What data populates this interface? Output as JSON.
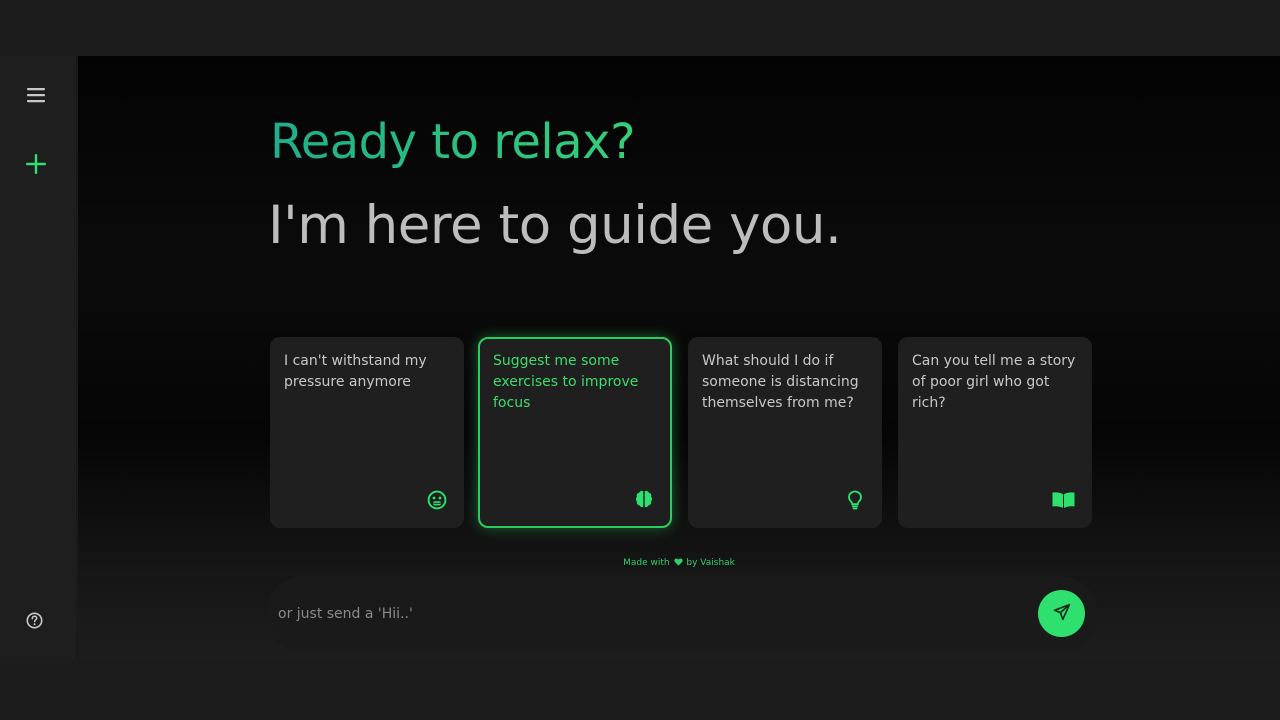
{
  "sidebar": {
    "menu_icon": "menu-icon",
    "new_chat_icon": "plus-icon",
    "help_icon": "help-icon"
  },
  "greeting": {
    "line1": "Ready to relax?",
    "line2": "I'm here to guide you."
  },
  "cards": [
    {
      "text": "I can't withstand my pressure anymore",
      "icon": "stressed-face-icon",
      "active": false
    },
    {
      "text": "Suggest me some exercises to improve focus",
      "icon": "brain-icon",
      "active": true
    },
    {
      "text": "What should I do if someone is distancing themselves from me?",
      "icon": "lightbulb-icon",
      "active": false
    },
    {
      "text": "Can you tell me a story of poor girl who got rich?",
      "icon": "book-icon",
      "active": false
    }
  ],
  "footer": {
    "made_with": "Made with",
    "by": "by Vaishak",
    "heart_icon": "heart-icon"
  },
  "prompt": {
    "placeholder": "or just send a 'Hii..'",
    "value": "",
    "send_icon": "send-icon"
  },
  "colors": {
    "accent": "#2fe06e",
    "heading_gradient_start": "#1fae8a",
    "heading_gradient_end": "#35d07a",
    "card_bg": "#1f1f1f",
    "subheading": "#bdbdbd"
  }
}
